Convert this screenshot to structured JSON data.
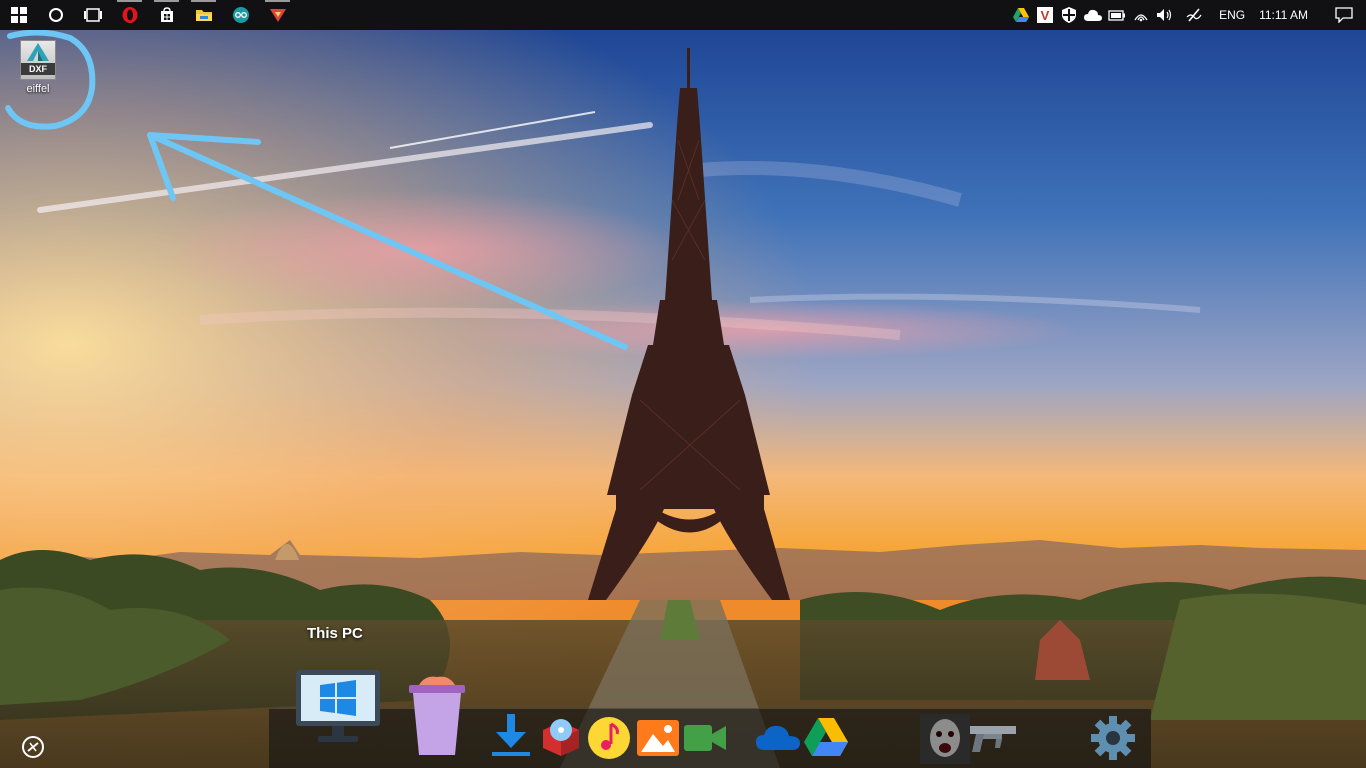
{
  "taskbar": {
    "apps": [
      {
        "name": "start",
        "running": false
      },
      {
        "name": "cortana",
        "running": false
      },
      {
        "name": "task-view",
        "running": false
      },
      {
        "name": "opera",
        "running": true
      },
      {
        "name": "store",
        "running": true
      },
      {
        "name": "file-explorer",
        "running": true
      },
      {
        "name": "arduino",
        "running": false
      },
      {
        "name": "red-app",
        "running": true
      }
    ],
    "tray": {
      "language": "ENG",
      "time": "11:11 AM"
    }
  },
  "desktop": {
    "file_icon_badge": "DXF",
    "file_name": "eiffel"
  },
  "dock": {
    "hover_label": "This PC",
    "items": [
      "this-pc",
      "recycle-bin",
      "downloads",
      "media-player",
      "music",
      "photos",
      "video",
      "onedrive",
      "google-drive",
      "game",
      "gun",
      "settings"
    ]
  },
  "colors": {
    "annotation": "#6ec6f5",
    "taskbar": "#111114",
    "windows_blue": "#1e88e5"
  }
}
